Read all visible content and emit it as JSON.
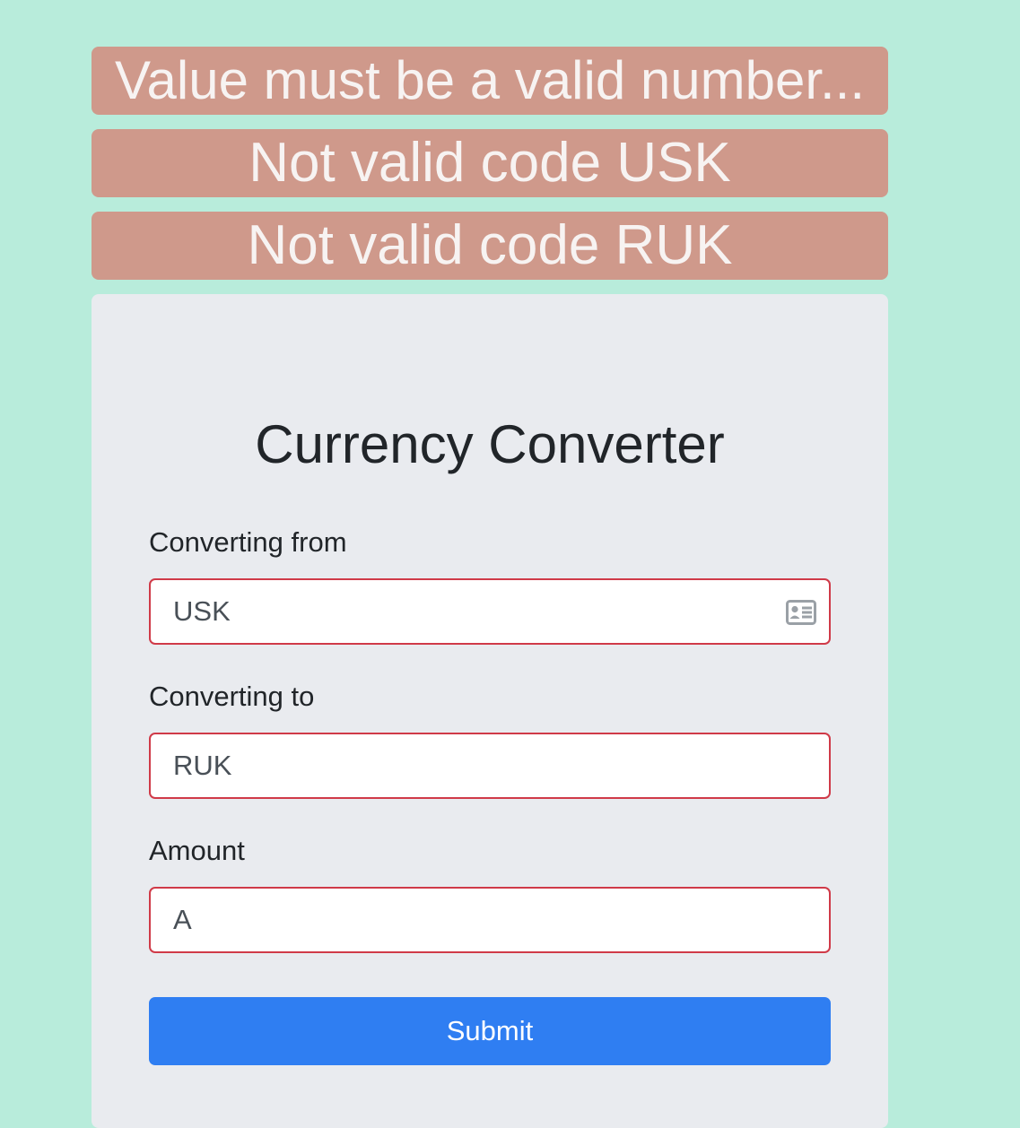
{
  "alerts": [
    "Value must be a valid number...",
    "Not valid code USK",
    "Not valid code RUK"
  ],
  "card": {
    "title": "Currency Converter"
  },
  "form": {
    "from": {
      "label": "Converting from",
      "value": "USK"
    },
    "to": {
      "label": "Converting to",
      "value": "RUK"
    },
    "amount": {
      "label": "Amount",
      "value": "A"
    },
    "submit_label": "Submit"
  },
  "icons": {
    "from_field_icon": "contact-card-icon"
  },
  "colors": {
    "background": "#b8ecdb",
    "alert": "#cf998b",
    "card": "#e9ebef",
    "invalid_border": "#d03a48",
    "primary": "#2f7ef2"
  }
}
